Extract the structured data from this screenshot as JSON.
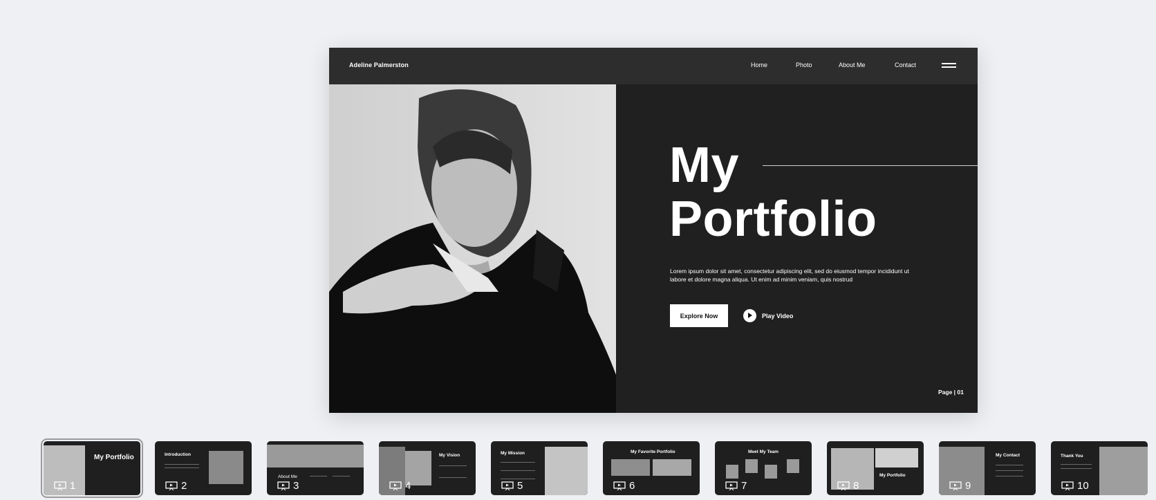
{
  "slide": {
    "brand": "Adeline Palmerston",
    "nav": [
      "Home",
      "Photo",
      "About Me",
      "Contact"
    ],
    "title_line1": "My",
    "title_line2": "Portfolio",
    "description": "Lorem ipsum dolor sit amet, consectetur adipiscing elit, sed do eiusmod tempor incididunt ut labore et dolore magna aliqua. Ut enim ad minim veniam, quis nostrud",
    "explore_label": "Explore Now",
    "play_label": "Play Video",
    "page_label": "Page | 01"
  },
  "thumbnails": {
    "active": "1",
    "items": [
      {
        "num": "1",
        "title": "My Portfolio"
      },
      {
        "num": "2",
        "title": "Introduction"
      },
      {
        "num": "3",
        "title": "About Me"
      },
      {
        "num": "4",
        "title": "My Vision"
      },
      {
        "num": "5",
        "title": "My Mission"
      },
      {
        "num": "6",
        "title": "My Favorite Portfolio"
      },
      {
        "num": "7",
        "title": "Meet My Team"
      },
      {
        "num": "8",
        "title": "My Portfolio"
      },
      {
        "num": "9",
        "title": "My Contact"
      },
      {
        "num": "10",
        "title": "Thank You"
      }
    ]
  }
}
